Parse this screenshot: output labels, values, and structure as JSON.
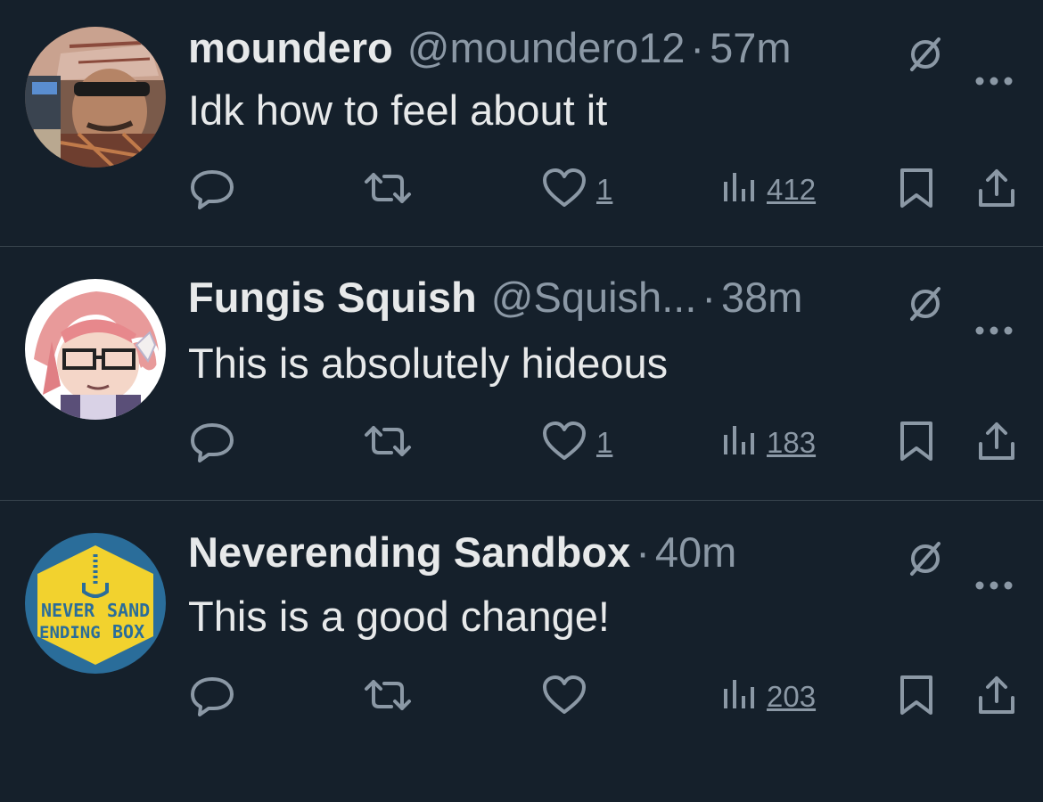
{
  "tweets": [
    {
      "name": "moundero",
      "handle": "@moundero12",
      "separator": "·",
      "time": "57m",
      "text": "Idk how to feel about it",
      "likes": "1",
      "views": "412"
    },
    {
      "name": "Fungis Squish",
      "handle": "@Squish...",
      "separator": "·",
      "time": "38m",
      "text": "This is absolutely hideous",
      "likes": "1",
      "views": "183"
    },
    {
      "name": "Neverending Sandbox",
      "handle": "",
      "separator": "·",
      "time": "40m",
      "text": "This is a good change!",
      "likes": "",
      "views": "203",
      "avatar_logo": {
        "line1": "NEVER",
        "line2": "ENDING",
        "line3": "SAND",
        "line4": "BOX"
      }
    }
  ],
  "colors": {
    "background": "#15202b",
    "primary_text": "#e7e9ea",
    "secondary_text": "#8b98a5",
    "divider": "#38444d"
  },
  "icons": [
    "reply-icon",
    "retweet-icon",
    "like-icon",
    "views-icon",
    "bookmark-icon",
    "share-icon",
    "grok-icon",
    "more-icon"
  ]
}
